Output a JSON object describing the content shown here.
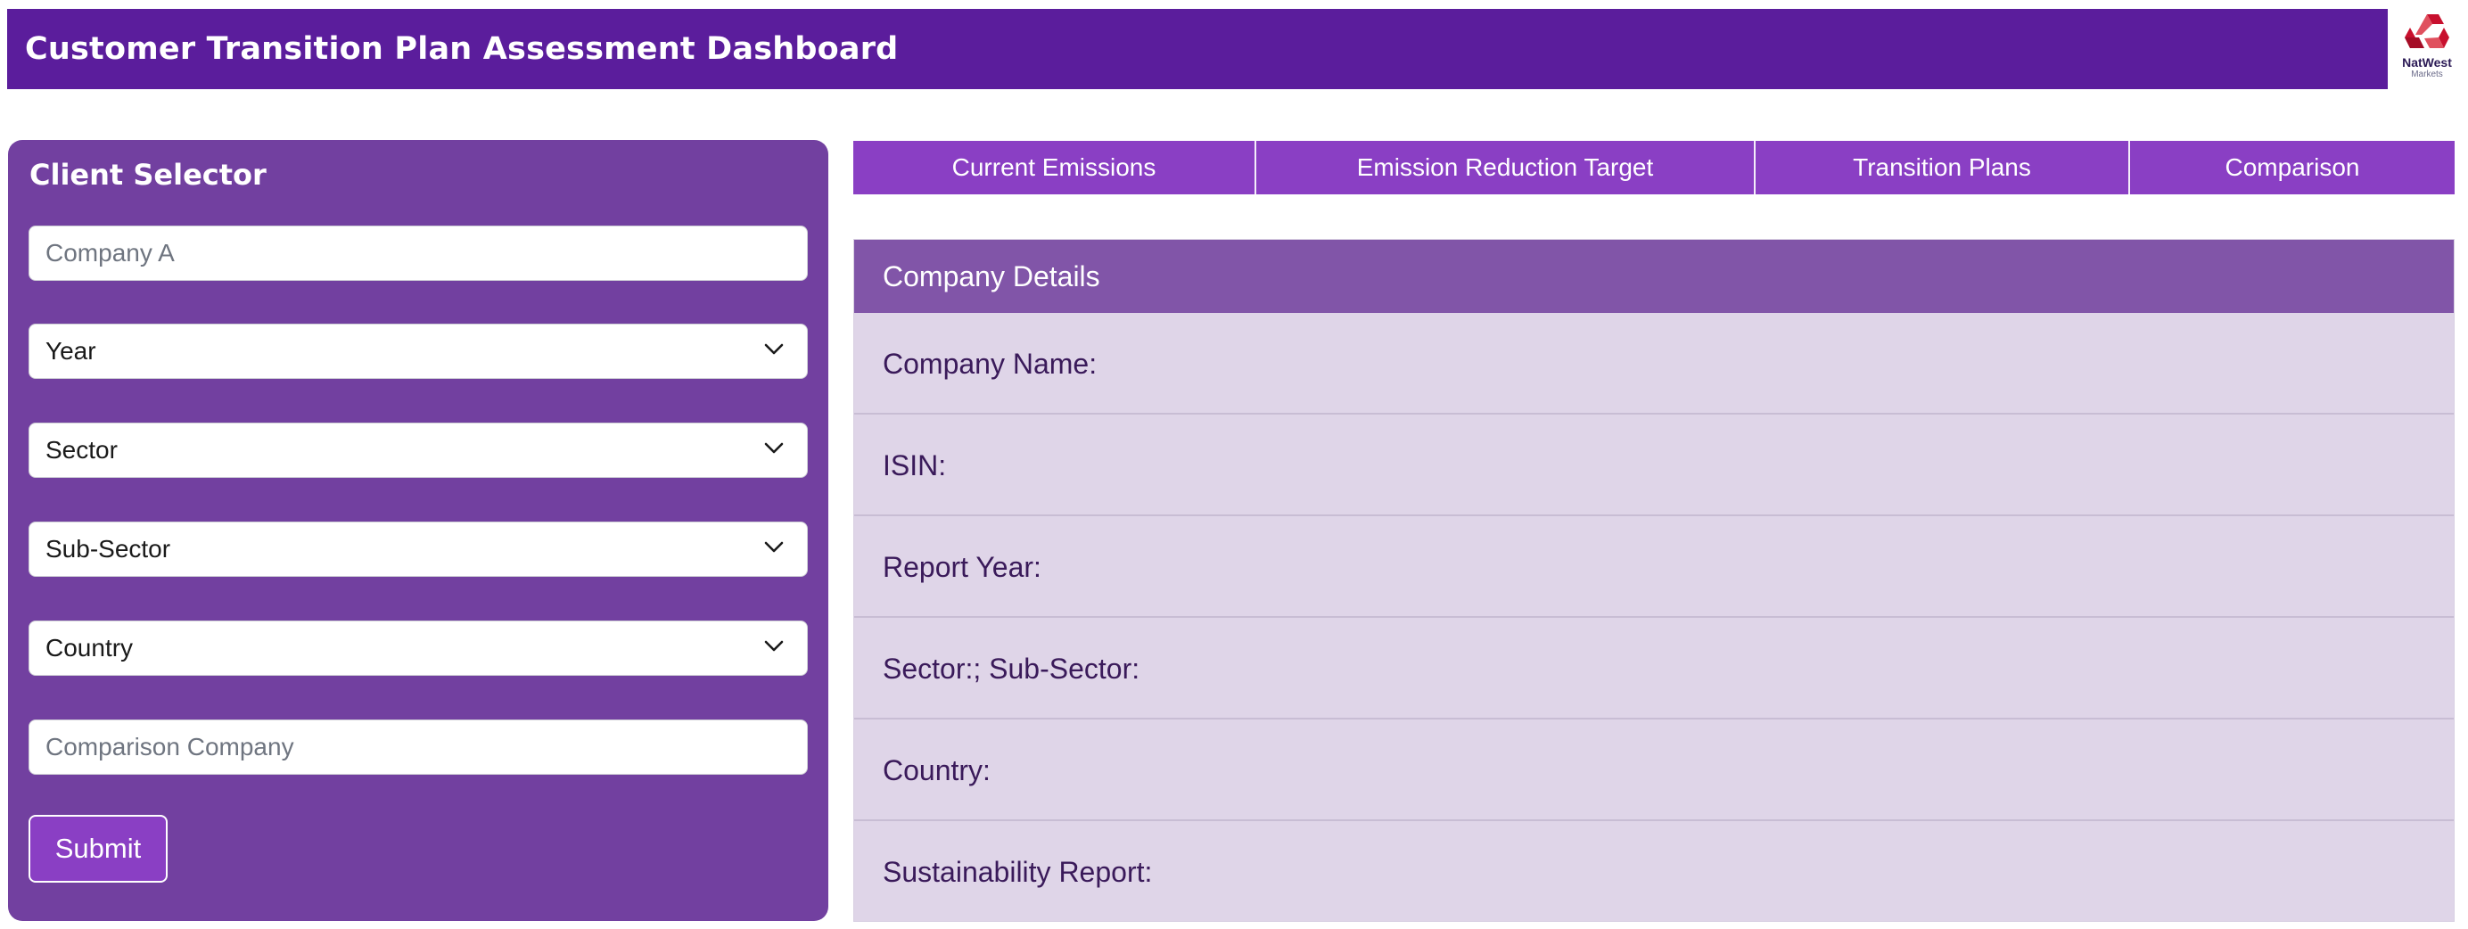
{
  "header": {
    "title": "Customer Transition Plan Assessment Dashboard",
    "logo_name": "NatWest",
    "logo_sub": "Markets",
    "logo_color": "#c8102e"
  },
  "client_selector": {
    "title": "Client Selector",
    "company_placeholder": "Company A",
    "year_label": "Year",
    "sector_label": "Sector",
    "subsector_label": "Sub-Sector",
    "country_label": "Country",
    "comparison_placeholder": "Comparison Company",
    "submit_label": "Submit"
  },
  "tabs": [
    {
      "label": "Current Emissions"
    },
    {
      "label": "Emission Reduction Target"
    },
    {
      "label": "Transition Plans"
    },
    {
      "label": "Comparison"
    }
  ],
  "company_details": {
    "title": "Company Details",
    "rows": [
      {
        "label": "Company Name:"
      },
      {
        "label": "ISIN:"
      },
      {
        "label": "Report Year:"
      },
      {
        "label": "Sector:; Sub-Sector:"
      },
      {
        "label": "Country:"
      },
      {
        "label": "Sustainability Report:"
      }
    ]
  },
  "colors": {
    "header_bg": "#5b1d9c",
    "panel_bg": "#7240a0",
    "tab_bg": "#8a3fc4",
    "details_header_bg": "#8155a8",
    "details_bg": "#dfd5e8"
  }
}
